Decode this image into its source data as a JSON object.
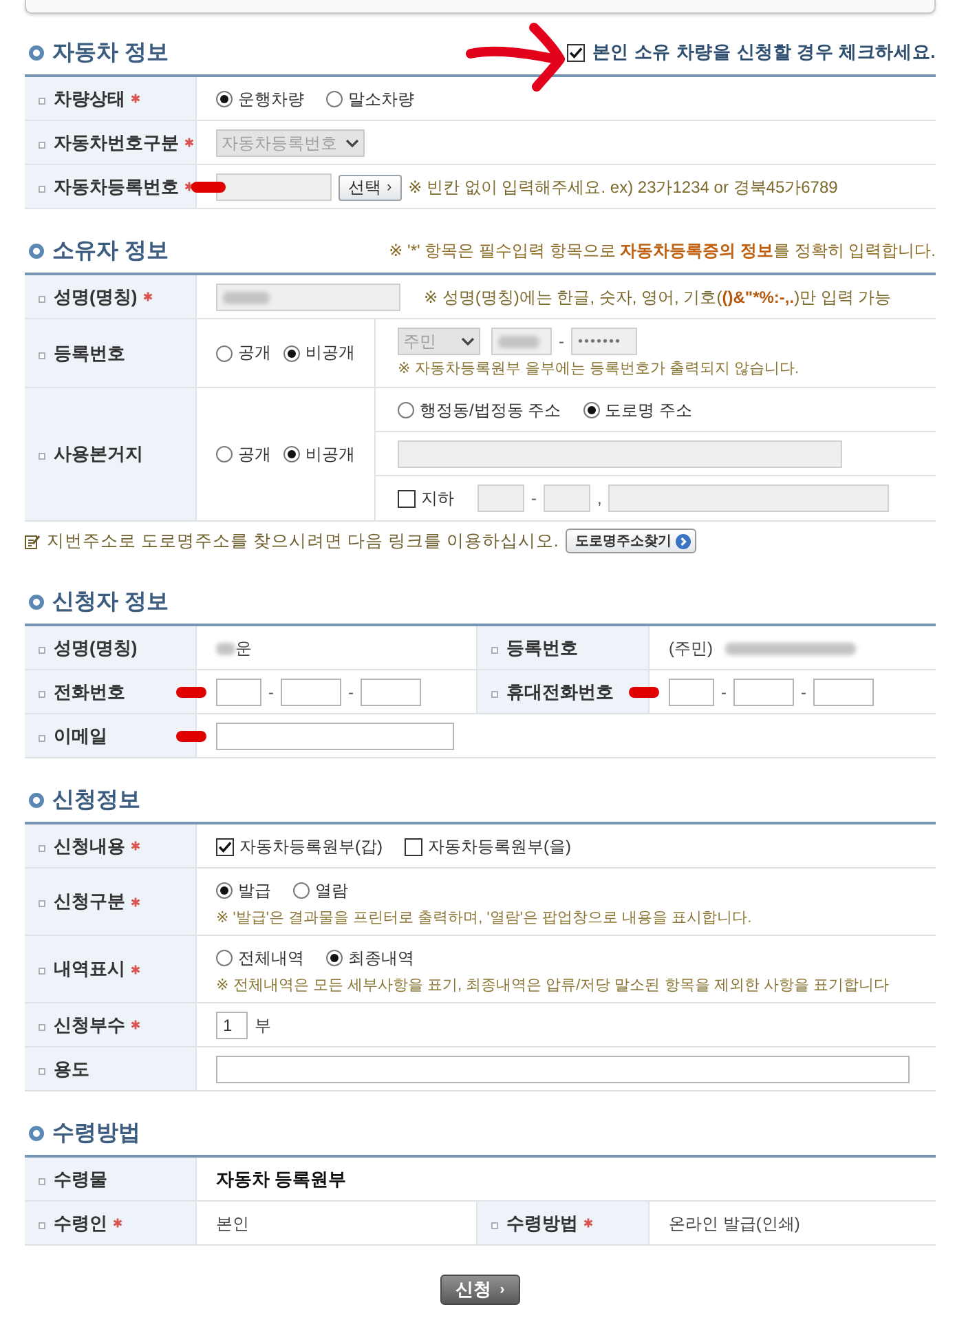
{
  "vehicle": {
    "title": "자동차 정보",
    "owner_check": {
      "label": "본인 소유 차량을 신청할 경우 체크하세요.",
      "checked": true,
      "annotated": true
    },
    "rows": [
      {
        "kind": "radio",
        "label": "차량상태",
        "required": true,
        "options": [
          {
            "label": "운행차량",
            "selected": true
          },
          {
            "label": "말소차량",
            "selected": false
          }
        ]
      },
      {
        "kind": "select",
        "label": "자동차번호구분",
        "required": true,
        "select": {
          "value": "자동차등록번호",
          "disabled": true
        }
      },
      {
        "kind": "plate",
        "label": "자동차등록번호",
        "required": true,
        "marked": true,
        "disabled": true,
        "button": {
          "label": "선택",
          "icon": "›"
        },
        "note": "※ 빈칸 없이 입력해주세요. ex) 23가1234 or 경북45가6789"
      }
    ]
  },
  "owner": {
    "title": "소유자 정보",
    "notice": "※ '*' 항목은 필수입력 항목으로 **자동차등록증의 정보**를 정확히 입력합니다.",
    "rows": [
      {
        "kind": "name",
        "label": "성명(명칭)",
        "required": true,
        "disabled": true,
        "blurred": true,
        "note": "※ 성명(명칭)에는 한글, 숫자, 영어, 기호(**()&\"*%:-,.**)만 입력 가능"
      },
      {
        "kind": "id",
        "label": "등록번호",
        "required": false,
        "visibility": [
          {
            "label": "공개",
            "selected": false
          },
          {
            "label": "비공개",
            "selected": true
          }
        ],
        "select": {
          "value": "주민",
          "disabled": true
        },
        "disabled": true,
        "blurred": true,
        "separator": "-",
        "masked": "•••••••",
        "note": "※ 자동차등록원부 을부에는 등록번호가 출력되지 않습니다."
      },
      {
        "kind": "address",
        "label": "사용본거지",
        "required": false,
        "visibility": [
          {
            "label": "공개",
            "selected": false
          },
          {
            "label": "비공개",
            "selected": true
          }
        ],
        "address_types": [
          {
            "label": "행정동/법정동 주소",
            "selected": false
          },
          {
            "label": "도로명 주소",
            "selected": true
          }
        ],
        "disabled": true,
        "basement": {
          "label": "지하",
          "checked": false
        },
        "separators": [
          "-",
          ","
        ]
      }
    ],
    "hint": {
      "text": "지번주소로 도로명주소를 찾으시려면 다음 링크를 이용하십시오.",
      "button": "도로명주소찾기"
    }
  },
  "applicant": {
    "title": "신청자 정보",
    "rows": [
      {
        "kind": "fields",
        "fields": [
          {
            "label": "성명(명칭)",
            "required": false,
            "parts": [
              {
                "kind": "blurred_name"
              },
              {
                "kind": "text",
                "text": "운"
              }
            ]
          },
          {
            "label": "등록번호",
            "required": false,
            "parts": [
              {
                "kind": "text",
                "text": "(주민)"
              },
              {
                "kind": "blurred_number"
              }
            ]
          }
        ]
      },
      {
        "kind": "fields",
        "fields": [
          {
            "label": "전화번호",
            "required": false,
            "marked": true,
            "parts": [
              {
                "kind": "prefix_input",
                "disabled": false
              },
              {
                "kind": "separator",
                "text": "-"
              },
              {
                "kind": "number_input",
                "disabled": false
              },
              {
                "kind": "separator",
                "text": "-"
              },
              {
                "kind": "number_input",
                "disabled": false
              }
            ]
          },
          {
            "label": "휴대전화번호",
            "required": false,
            "marked": true,
            "parts": [
              {
                "kind": "prefix_input",
                "disabled": false
              },
              {
                "kind": "separator",
                "text": "-"
              },
              {
                "kind": "number_input",
                "disabled": false
              },
              {
                "kind": "separator",
                "text": "-"
              },
              {
                "kind": "number_input",
                "disabled": false
              }
            ]
          }
        ]
      },
      {
        "kind": "fields",
        "fields": [
          {
            "label": "이메일",
            "required": false,
            "marked": true,
            "parts": [
              {
                "kind": "email_input",
                "disabled": false
              }
            ]
          }
        ]
      }
    ]
  },
  "application": {
    "title": "신청정보",
    "rows": [
      {
        "kind": "checks",
        "label": "신청내용",
        "required": true,
        "options": [
          {
            "label": "자동차등록원부(갑)",
            "checked": true
          },
          {
            "label": "자동차등록원부(을)",
            "checked": false
          }
        ]
      },
      {
        "kind": "radio",
        "label": "신청구분",
        "required": true,
        "options": [
          {
            "label": "발급",
            "selected": true
          },
          {
            "label": "열람",
            "selected": false
          }
        ],
        "note": "※ '발급'은 결과물을 프린터로 출력하며, '열람'은 팝업창으로 내용을 표시합니다."
      },
      {
        "kind": "radio",
        "label": "내역표시",
        "required": true,
        "options": [
          {
            "label": "전체내역",
            "selected": false
          },
          {
            "label": "최종내역",
            "selected": true
          }
        ],
        "note": "※ 전체내역은 모든 세부사항을 표기, 최종내역은 압류/저당 말소된 항목을 제외한 사항을 표기합니다"
      },
      {
        "kind": "count",
        "label": "신청부수",
        "required": true,
        "disabled": false,
        "value": "1",
        "unit": "부"
      },
      {
        "kind": "wide_input",
        "label": "용도",
        "required": false,
        "disabled": false
      }
    ]
  },
  "receipt": {
    "title": "수령방법",
    "rows": [
      {
        "kind": "bold_text",
        "label": "수령물",
        "required": false,
        "value": "자동차 등록원부"
      },
      {
        "kind": "fields",
        "fields": [
          {
            "label": "수령인",
            "required": true,
            "parts": [
              {
                "kind": "text",
                "text": "본인"
              }
            ]
          },
          {
            "label": "수령방법",
            "required": true,
            "parts": [
              {
                "kind": "text",
                "text": "온라인 발급(인쇄)"
              }
            ]
          }
        ]
      }
    ]
  },
  "submit": {
    "label": "신청",
    "icon": "›"
  }
}
